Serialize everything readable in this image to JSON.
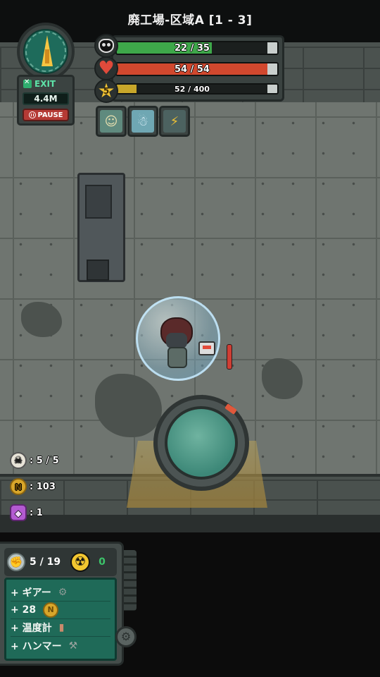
{
  "header": {
    "stage_title": "廃工場-区域A [1 - 3]"
  },
  "navigator": {
    "exit_label": "EXIT",
    "exit_distance": "4.4M",
    "pause_label": "PAUSE",
    "arrow_icon": "compass-arrow-icon"
  },
  "stats": {
    "oxygen": {
      "text": "22 / 35",
      "current": 22,
      "max": 35,
      "color": "#3ea84a",
      "icon": "gas-mask-icon"
    },
    "health": {
      "text": "54 / 54",
      "current": 54,
      "max": 54,
      "color": "#d1482e",
      "icon": "heart-icon"
    },
    "experience": {
      "text": "52 / 400",
      "current": 52,
      "max": 400,
      "color": "#c8a72a",
      "icon": "star-icon",
      "level": "5"
    }
  },
  "skills": [
    {
      "icon": "worker-skill-icon",
      "glyph": "☺"
    },
    {
      "icon": "ghost-skill-icon",
      "glyph": "☃"
    },
    {
      "icon": "battery-skill-icon",
      "glyph": "⚡"
    }
  ],
  "counters": {
    "keys": {
      "icon": "skull-key-icon",
      "text": ": 5 / 5"
    },
    "coins": {
      "icon": "coin-icon",
      "text": ": 103"
    },
    "gems": {
      "icon": "gem-icon",
      "text": ": 1"
    }
  },
  "loot": {
    "capacity": "5 / 19",
    "capacity_icon": "muscle-icon",
    "radiation_icon": "radiation-icon",
    "radiation": "0",
    "items": [
      {
        "label": "+ ギアー",
        "icon": "gear-icon"
      },
      {
        "label": "+ 28",
        "icon": "coin-icon"
      },
      {
        "label": "+ 温度計",
        "icon": "thermometer-icon"
      },
      {
        "label": "+ ハンマー",
        "icon": "hammer-icon"
      }
    ]
  },
  "colors": {
    "accent_green": "#1f6a58",
    "panel": "#3b4341",
    "pause_red": "#b53a35"
  }
}
